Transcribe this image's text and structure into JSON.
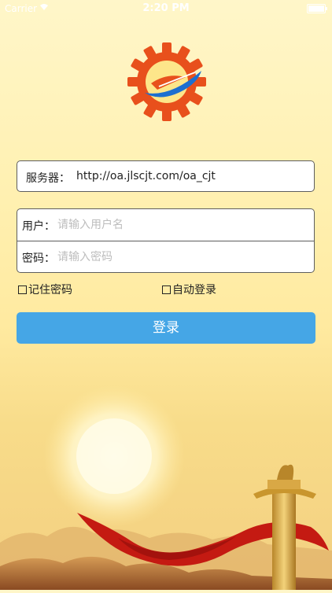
{
  "status_bar": {
    "carrier": "Carrier",
    "time": "2:20 PM",
    "wifi_icon": "wifi-icon",
    "battery_icon": "battery-icon"
  },
  "logo": {
    "icon": "gear-e-logo",
    "colors": {
      "gear": "#e8501c",
      "swoosh": "#1c6fd0"
    }
  },
  "server": {
    "label": "服务器：",
    "value": "http://oa.jlscjt.com/oa_cjt"
  },
  "username": {
    "label": "用户：",
    "placeholder": "请输入用户名",
    "value": ""
  },
  "password": {
    "label": "密码：",
    "placeholder": "请输入密码",
    "value": ""
  },
  "options": {
    "remember_password": "记住密码",
    "auto_login": "自动登录"
  },
  "login_button": {
    "label": "登录",
    "color": "#45a6e6"
  },
  "background": {
    "scene": "sunrise-monument-red-ribbon"
  }
}
